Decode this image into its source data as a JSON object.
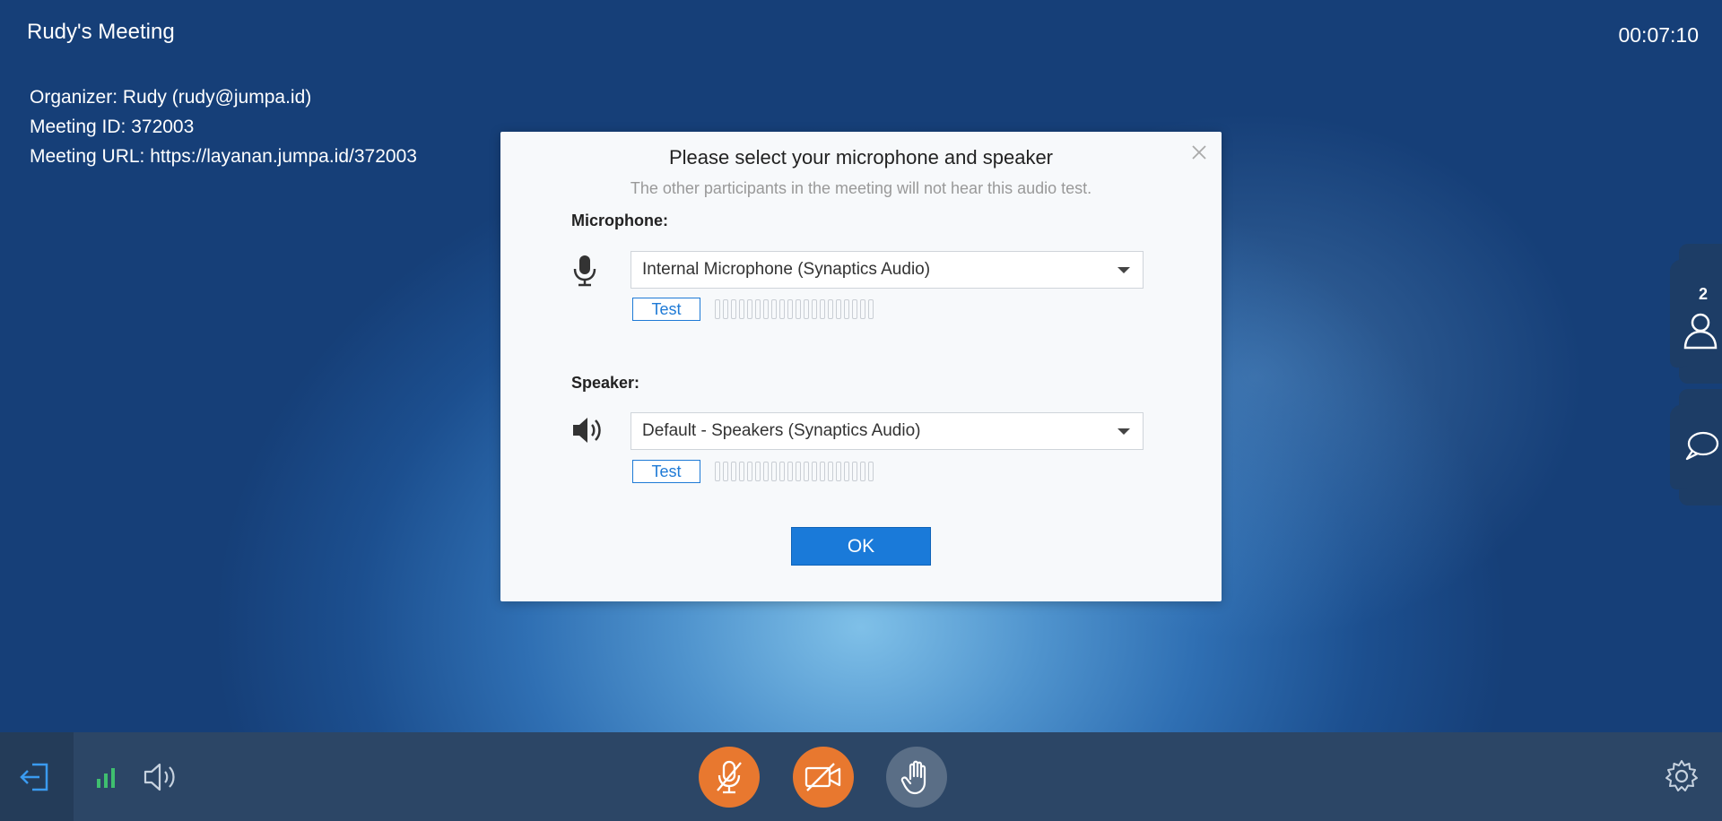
{
  "meeting": {
    "title": "Rudy's Meeting",
    "timer": "00:07:10",
    "organizer": "Organizer: Rudy (rudy@jumpa.id)",
    "meeting_id": "Meeting ID: 372003",
    "meeting_url": "Meeting URL: https://layanan.jumpa.id/372003"
  },
  "sidebar": {
    "participant_count": "2",
    "icons": [
      "participants-icon",
      "chat-icon"
    ]
  },
  "dialog": {
    "title": "Please select your microphone and speaker",
    "subtitle": "The other participants in the meeting will not hear this audio test.",
    "microphone_label": "Microphone:",
    "microphone_value": "Internal Microphone (Synaptics Audio)",
    "microphone_test": "Test",
    "speaker_label": "Speaker:",
    "speaker_value": "Default - Speakers (Synaptics Audio)",
    "speaker_test": "Test",
    "ok_label": "OK",
    "meter_segments": 20,
    "microphone_level": 0,
    "speaker_level": 0
  },
  "toolbar": {
    "icons": [
      "leave-icon",
      "signal-icon",
      "speaker-icon",
      "mic-muted-icon",
      "video-off-icon",
      "raise-hand-icon",
      "settings-icon"
    ],
    "colors": {
      "accent": "#1a7ad9",
      "muted_control": "#e8782f",
      "signal": "#3fbf6f"
    }
  }
}
